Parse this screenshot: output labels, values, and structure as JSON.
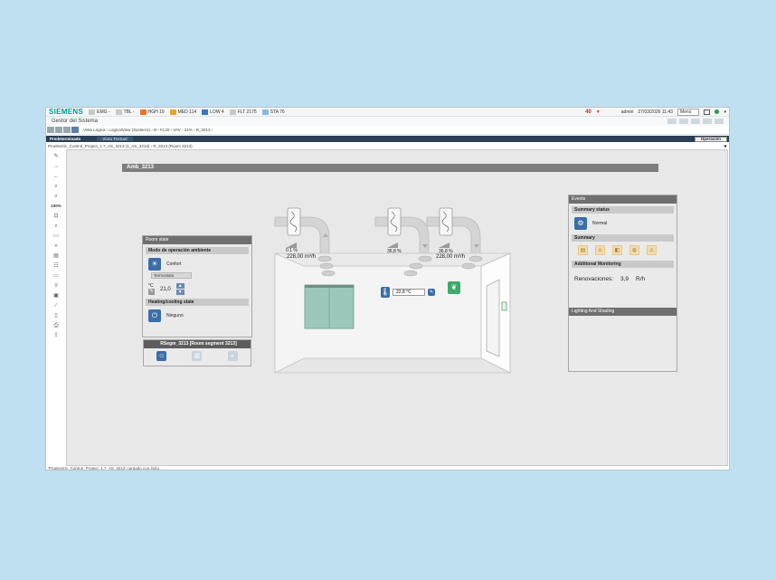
{
  "topbar": {
    "brand": "SIEMENS",
    "alarms": [
      {
        "label": "EMG -",
        "color": "#c8c8c8"
      },
      {
        "label": "TBL -",
        "color": "#c8c8c8"
      },
      {
        "label": "HGH 19",
        "color": "#e8742b"
      },
      {
        "label": "MED 114",
        "color": "#e8a52b"
      },
      {
        "label": "LOW 4",
        "color": "#3b74c8"
      },
      {
        "label": "FLT 2175",
        "color": "#c8c8c8"
      },
      {
        "label": "STA 76",
        "color": "#8ab8d8"
      }
    ],
    "alarm_flag": "40",
    "user": "admin",
    "datetime": "27/03/2026 11:43",
    "menu_label": "Menú"
  },
  "titlebar": {
    "title": "Gestor del Sistema"
  },
  "navbar": {
    "breadcrumbs": "Vista Lógica  ›  LogicalView (System1)  ›  B  ›  FL20  ›  VAV  ›  21%  ›  R_3213  ›"
  },
  "tabs": {
    "predeterminado": "Predeterminado",
    "vista_textual": "Vista Textual",
    "operacion": "Operación"
  },
  "pathbar": {
    "path": "Proelectric_Control_Project_1.7_AS_3213 (1_AS_3213)  ›  R_3213 (Room 3213)"
  },
  "toolbar": {
    "zoom": "100%"
  },
  "canvas": {
    "header": "Amb_3213",
    "room_state": {
      "title": "Room state",
      "mode_label": "Modo de operación ambiente",
      "mode_value": "Confort",
      "thermostat_label": "Termostato",
      "unit": "°C",
      "setpoint": "21,0",
      "heating_label": "Heating/cooling state",
      "heating_value": "Ninguno"
    },
    "segment": {
      "title": "RSegm_3213 [Room segment 3213]"
    },
    "room": {
      "vav1_pct": "0.1 %",
      "vav1_flow": "228,00 m³/h",
      "vav2_pct": "36,8 %",
      "vav3_pct": "36,8 %",
      "vav3_flow": "228,00 m³/h",
      "temperature": "22,8 °C"
    },
    "events": {
      "title": "Events",
      "summary_status_label": "Summary status",
      "summary_status_value": "Normal",
      "summary_label": "Summary",
      "additional_label": "Additional Monitoring",
      "renovaciones_label": "Renovaciones:",
      "renovaciones_value": "3,9",
      "renovaciones_unit": "R/h",
      "lighting_label": "Lighting And Shading"
    }
  },
  "status": {
    "text": "'Proelectric_Control_Project_1.7_AS_3213' cargado con éxito"
  }
}
